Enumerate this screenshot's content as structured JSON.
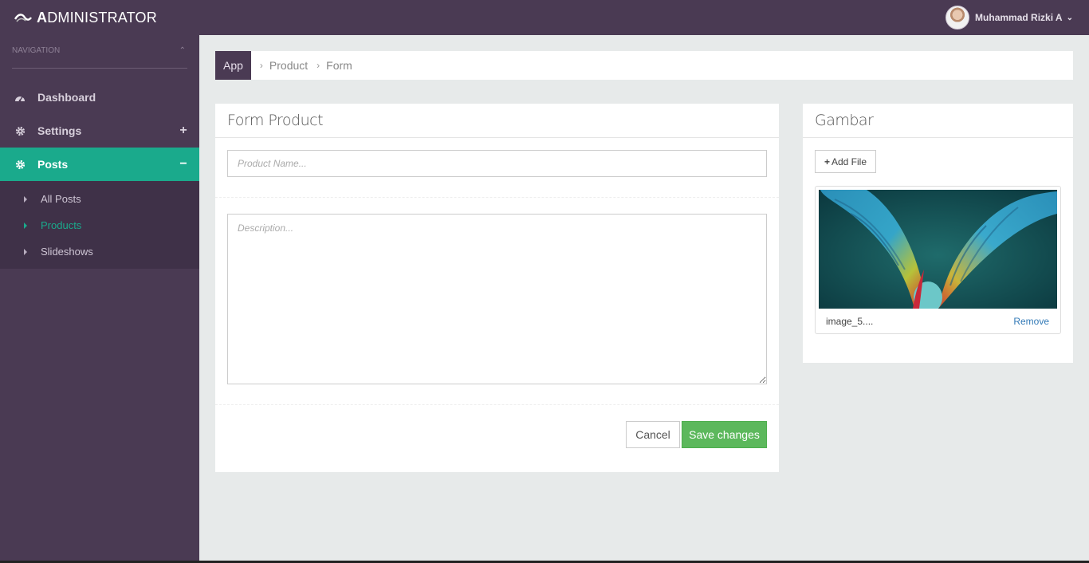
{
  "brand": {
    "first_letter": "A",
    "rest": "DMINISTRATOR"
  },
  "sidebar": {
    "nav_header": "NAVIGATION",
    "items": [
      {
        "label": "Dashboard",
        "icon": "dashboard-icon",
        "toggle": ""
      },
      {
        "label": "Settings",
        "icon": "gear-icon",
        "toggle": "+"
      },
      {
        "label": "Posts",
        "icon": "gear-icon",
        "toggle": "−"
      }
    ],
    "sub_items": [
      {
        "label": "All Posts"
      },
      {
        "label": "Products"
      },
      {
        "label": "Slideshows"
      }
    ],
    "active_item": "Posts",
    "active_sub_item": "Products"
  },
  "topbar": {
    "user_name": "Muhammad Rizki A"
  },
  "breadcrumb": [
    "App",
    "Product",
    "Form"
  ],
  "form": {
    "title": "Form Product",
    "product_name_placeholder": "Product Name...",
    "product_name_value": "",
    "description_placeholder": "Description...",
    "description_value": "",
    "cancel_label": "Cancel",
    "save_label": "Save changes"
  },
  "gambar": {
    "title": "Gambar",
    "add_file_label": "Add File",
    "file_name": "image_5....",
    "remove_label": "Remove"
  },
  "colors": {
    "sidebar_bg": "#4a3a53",
    "accent": "#1aaa8c",
    "save_button": "#5cb85c",
    "link": "#337ab7"
  }
}
